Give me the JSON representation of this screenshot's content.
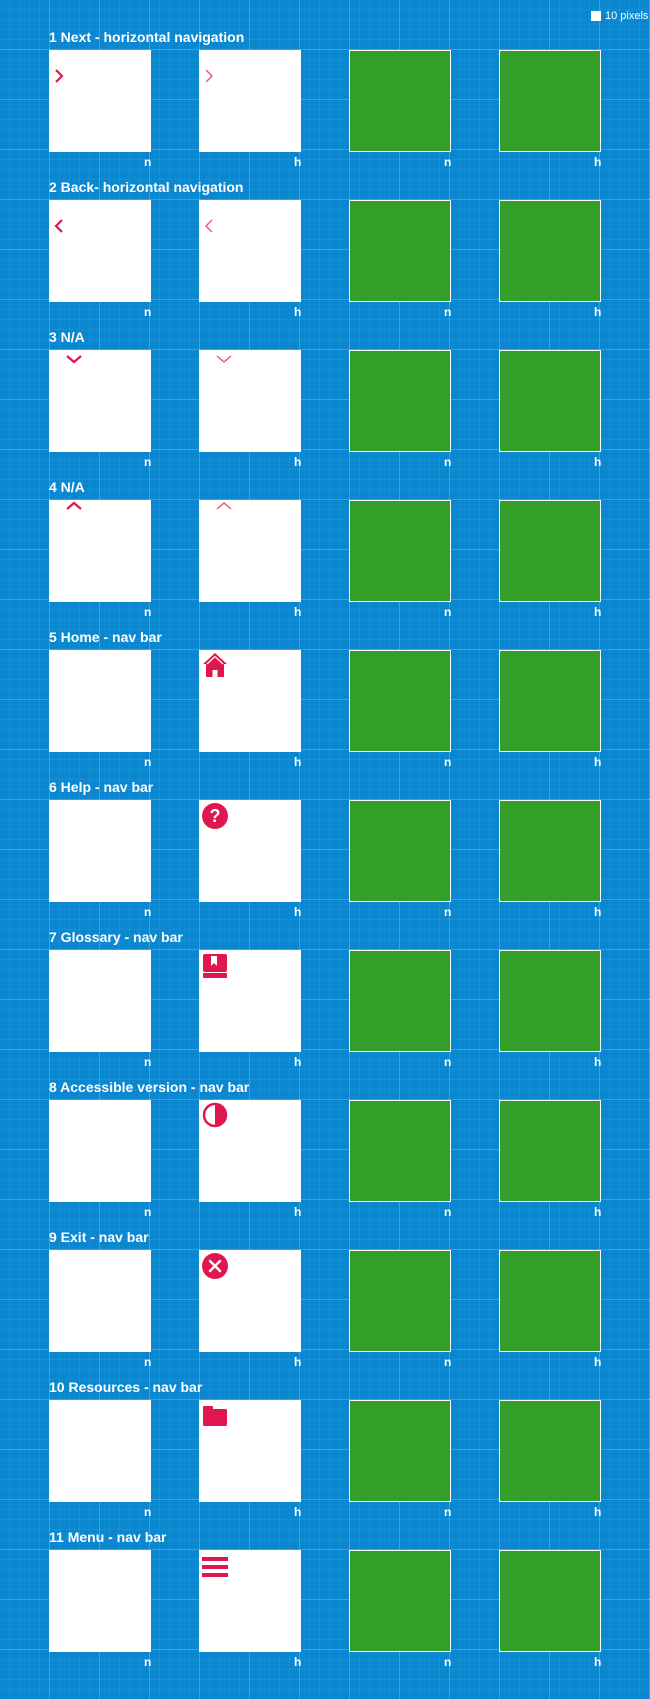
{
  "legend": {
    "label": "10 pixels"
  },
  "colors": {
    "background": "#0a87cf",
    "grid": "#4da9df",
    "tile_white": "#ffffff",
    "tile_green": "#339e28",
    "icon_accent": "#e0174f"
  },
  "sections": [
    {
      "title": "1 Next - horizontal navigation",
      "icon": "chevron-right-icon",
      "states": [
        "n",
        "h",
        "n",
        "h"
      ]
    },
    {
      "title": "2 Back- horizontal navigation",
      "icon": "chevron-left-icon",
      "states": [
        "n",
        "h",
        "n",
        "h"
      ]
    },
    {
      "title": "3 N/A",
      "icon": "chevron-down-icon",
      "states": [
        "n",
        "h",
        "n",
        "h"
      ]
    },
    {
      "title": "4 N/A",
      "icon": "chevron-up-icon",
      "states": [
        "n",
        "h",
        "n",
        "h"
      ]
    },
    {
      "title": "5 Home - nav bar",
      "icon": "home-icon",
      "states": [
        "n",
        "h",
        "n",
        "h"
      ]
    },
    {
      "title": "6 Help - nav bar",
      "icon": "help-icon",
      "states": [
        "n",
        "h",
        "n",
        "h"
      ]
    },
    {
      "title": "7 Glossary - nav bar",
      "icon": "book-icon",
      "states": [
        "n",
        "h",
        "n",
        "h"
      ]
    },
    {
      "title": "8 Accessible version - nav bar",
      "icon": "contrast-icon",
      "states": [
        "n",
        "h",
        "n",
        "h"
      ]
    },
    {
      "title": "9 Exit - nav bar",
      "icon": "exit-icon",
      "states": [
        "n",
        "h",
        "n",
        "h"
      ]
    },
    {
      "title": "10 Resources - nav bar",
      "icon": "folder-icon",
      "states": [
        "n",
        "h",
        "n",
        "h"
      ]
    },
    {
      "title": "11 Menu - nav bar",
      "icon": "menu-icon",
      "states": [
        "n",
        "h",
        "n",
        "h"
      ]
    }
  ]
}
